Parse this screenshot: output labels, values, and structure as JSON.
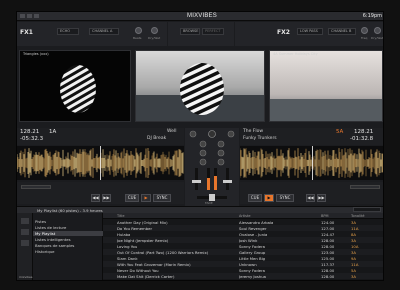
{
  "brand": "MIXVIBES",
  "clock": "6:19pm",
  "fx": {
    "left": {
      "label": "FX1",
      "effect": "ECHO",
      "channel": "CHANNEL A",
      "knob1": "Beats",
      "knob2": "Dry/Wet"
    },
    "center": {
      "tab1": "BROWSE",
      "tab2": "PERFECT"
    },
    "right": {
      "label": "FX2",
      "effect": "LOW PASS",
      "channel": "CHANNEL B",
      "knob1": "Freq",
      "knob2": "Dry/Wet"
    }
  },
  "video": {
    "left_title": "Triangles (xxx)",
    "right_title": "4A  Summer Holidays City"
  },
  "deck_left": {
    "bpm": "128.21",
    "key": "1A",
    "time": "-05:32.3",
    "title": "Well",
    "artist": "DJ Break",
    "cue": "CUE",
    "sync": "SYNC"
  },
  "deck_right": {
    "title": "The Flow",
    "artist": "Funky Trunkers",
    "bpm": "128.21",
    "key": "5A",
    "time": "-01:32.8",
    "cue": "CUE",
    "sync": "SYNC"
  },
  "mixer": {
    "fader": "FADE"
  },
  "browser": {
    "header": "My Playlist (60 pistes) - 3.9 heures",
    "tree": [
      "Pistes",
      "Listes de lecture",
      "My Playlist",
      "Listes intelligentes",
      "Banques de samples",
      "Historique"
    ],
    "columns": [
      "Title",
      "Artiste",
      "BPM",
      "Tonalité"
    ],
    "tracks": [
      {
        "title": "Another Day (Original Mix)",
        "artist": "Alessandro Arbala",
        "bpm": "124.00",
        "key": "3A"
      },
      {
        "title": "Do You Remember",
        "artist": "Soul Revenger",
        "bpm": "127.00",
        "key": "11A"
      },
      {
        "title": "Hulaba",
        "artist": "Ovalose - Junia",
        "bpm": "124.47",
        "key": "8A"
      },
      {
        "title": "Joe Night (Jempster Remix)",
        "artist": "Josh Wink",
        "bpm": "128.00",
        "key": "3A"
      },
      {
        "title": "Loving You",
        "artist": "Sonny Fodera",
        "bpm": "128.00",
        "key": "10A"
      },
      {
        "title": "Out Of Control (Part Two) (1200 Warriors Remix)",
        "artist": "Gallery Group",
        "bpm": "123.00",
        "key": "3A"
      },
      {
        "title": "Slam Dank",
        "artist": "Little Men Big",
        "bpm": "125.00",
        "key": "9A"
      },
      {
        "title": "With You Feat Grovemar (Marin Remix)",
        "artist": "Unknown",
        "bpm": "117.37",
        "key": "11A"
      },
      {
        "title": "Never Do Without You",
        "artist": "Sonny Fodera",
        "bpm": "128.00",
        "key": "5A"
      },
      {
        "title": "Make Dat Shit (Derrick Carter)",
        "artist": "Jeremy Joshua",
        "bpm": "128.00",
        "key": "3A"
      }
    ]
  }
}
